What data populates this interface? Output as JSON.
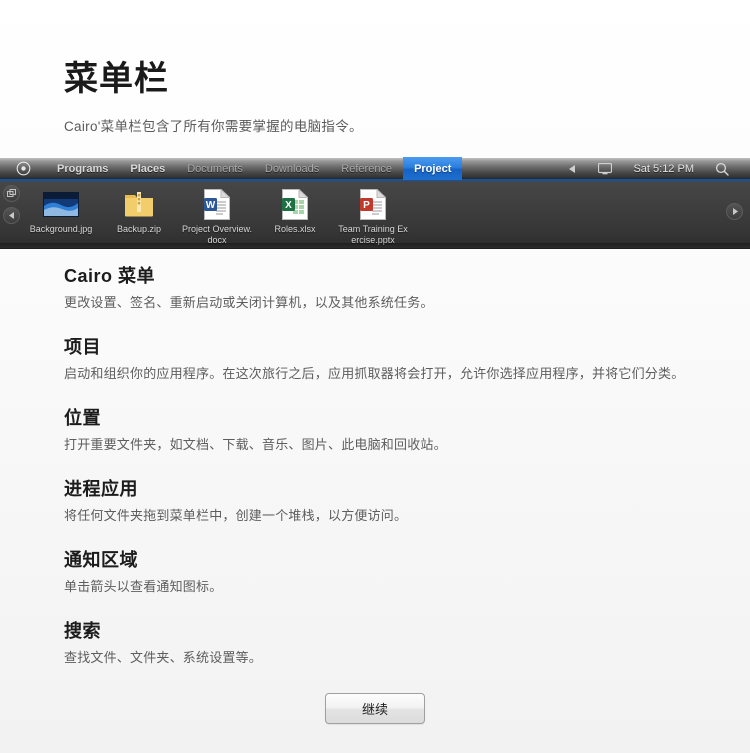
{
  "intro": {
    "title": "菜单栏",
    "subtitle": "Cairo'菜单栏包含了所有你需要掌握的电脑指令。"
  },
  "menubar": {
    "logo_icon": "cairo-logo-icon",
    "items": [
      {
        "label": "Programs",
        "state": "normal"
      },
      {
        "label": "Places",
        "state": "normal"
      },
      {
        "label": "Documents",
        "state": "dim"
      },
      {
        "label": "Downloads",
        "state": "dim"
      },
      {
        "label": "Reference",
        "state": "dim"
      },
      {
        "label": "Project",
        "state": "active"
      }
    ],
    "tray": {
      "collapse_icon": "left-arrow-icon",
      "display_icon": "monitor-icon",
      "clock": "Sat 5:12 PM",
      "search_icon": "search-icon"
    },
    "accent_color": "#1d6fd0"
  },
  "dock": {
    "scroll_left_icon": "left-arrow-icon",
    "scroll_right_icon": "right-arrow-icon",
    "window_icon": "windows-stack-icon",
    "files": [
      {
        "name": "Background.jpg",
        "type": "image"
      },
      {
        "name": "Backup.zip",
        "type": "zip"
      },
      {
        "name": "Project Overview.docx",
        "type": "word"
      },
      {
        "name": "Roles.xlsx",
        "type": "excel"
      },
      {
        "name": "Team Training Exercise.pptx",
        "type": "powerpoint"
      }
    ]
  },
  "sections": [
    {
      "title": "Cairo 菜单",
      "body": "更改设置、签名、重新启动或关闭计算机，以及其他系统任务。"
    },
    {
      "title": "项目",
      "body": "启动和组织你的应用程序。在这次旅行之后，应用抓取器将会打开，允许你选择应用程序，并将它们分类。"
    },
    {
      "title": "位置",
      "body": "打开重要文件夹，如文档、下载、音乐、图片、此电脑和回收站。"
    },
    {
      "title": "进程应用",
      "body": "将任何文件夹拖到菜单栏中，创建一个堆栈，以方便访问。"
    },
    {
      "title": "通知区域",
      "body": "单击箭头以查看通知图标。"
    },
    {
      "title": "搜索",
      "body": "查找文件、文件夹、系统设置等。"
    }
  ],
  "footer": {
    "continue_label": "继续"
  }
}
